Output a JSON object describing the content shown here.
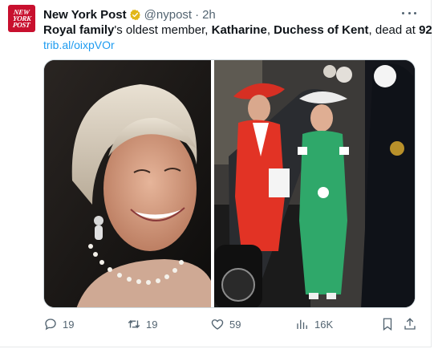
{
  "tweet": {
    "author_name": "New York Post",
    "author_handle": "@nypost",
    "separator": "·",
    "time": "2h",
    "avatar_text": [
      "NEW",
      "YORK",
      "POST"
    ],
    "text_segments": [
      {
        "t": "Royal family",
        "bold": true
      },
      {
        "t": "'s oldest member, ",
        "bold": false
      },
      {
        "t": "Katharine",
        "bold": true
      },
      {
        "t": ", ",
        "bold": false
      },
      {
        "t": "Duchess of Kent",
        "bold": true
      },
      {
        "t": ", dead at ",
        "bold": false
      },
      {
        "t": "92",
        "bold": true
      }
    ],
    "link": "trib.al/oixpVOr",
    "stats": {
      "replies": "19",
      "retweets": "19",
      "likes": "59",
      "views": "16K"
    }
  },
  "colors": {
    "brand_red": "#c8102e",
    "link_blue": "#1d9bf0",
    "verified_gold": "#e2b719",
    "muted": "#536471"
  },
  "icons": [
    "verified-badge-icon",
    "more-icon",
    "reply-icon",
    "retweet-icon",
    "like-icon",
    "views-icon",
    "bookmark-icon",
    "share-icon"
  ]
}
